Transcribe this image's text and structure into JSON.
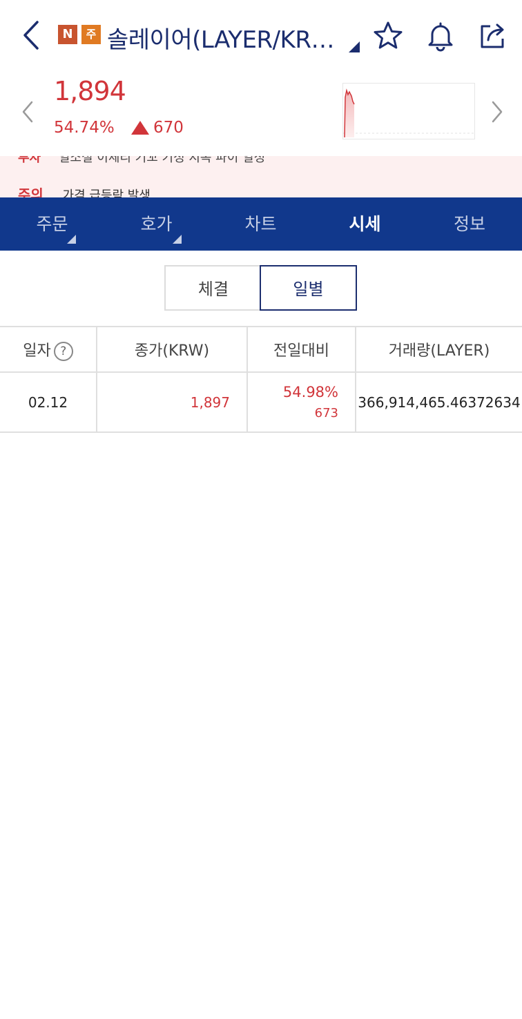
{
  "header": {
    "badge_n": "N",
    "badge_ju": "주",
    "title": "솔레이어(LAYER/KR…",
    "icons": [
      "back-icon",
      "star-icon",
      "bell-icon",
      "share-icon"
    ]
  },
  "quote": {
    "price": "1,894",
    "change_pct": "54.74%",
    "change_amount": "670",
    "direction": "up",
    "color_up": "#d1353a"
  },
  "notice": {
    "row1_tag": "투자",
    "row1_text": "일소절 이체리 기꼬 기정 지속 파이 일정",
    "row2_tag": "주의",
    "row2_text": "가격 급등락 발생"
  },
  "tabs": [
    {
      "label": "주문",
      "has_menu": true,
      "active": false
    },
    {
      "label": "호가",
      "has_menu": true,
      "active": false
    },
    {
      "label": "차트",
      "has_menu": false,
      "active": false
    },
    {
      "label": "시세",
      "has_menu": false,
      "active": true
    },
    {
      "label": "정보",
      "has_menu": false,
      "active": false
    }
  ],
  "segment": {
    "options": [
      "체결",
      "일별"
    ],
    "selected": "일별"
  },
  "table": {
    "headers": [
      "일자",
      "종가(KRW)",
      "전일대비",
      "거래량(LAYER)"
    ],
    "help_icon": "?",
    "rows": [
      {
        "date": "02.12",
        "close": "1,897",
        "change_rate": "54.98%",
        "change_amount": "673",
        "volume": "366,914,465.46372634"
      }
    ]
  },
  "colors": {
    "brand_navy": "#11388c",
    "title_navy": "#1b2d6e",
    "up_red": "#d1353a",
    "notice_bg": "#fdf0f0"
  }
}
